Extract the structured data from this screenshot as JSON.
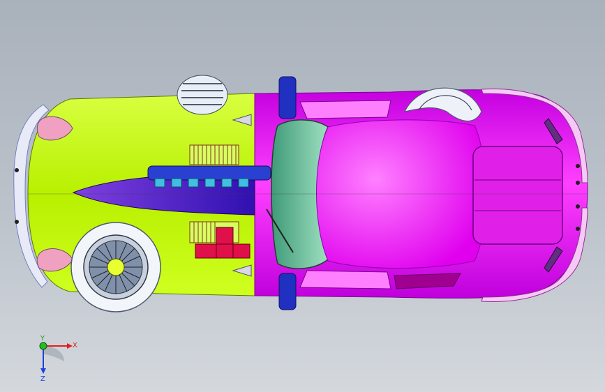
{
  "app": {
    "view": "Top",
    "model": "car assembly"
  },
  "colors": {
    "background_top": "#a9b1bb",
    "background_bottom": "#d4d8dd",
    "rear_body": "#b8f000",
    "rear_body_edge": "#e3ff3c",
    "front_body": "#f000f8",
    "front_body_dark": "#b000d0",
    "windshield": "#6ec8a0",
    "tire": "#f2f5fa",
    "spoke_hub": "#e8ff30",
    "bumper_blue": "#2030c0",
    "engine_purple": "#5020c8",
    "red_parts": "#e0104a",
    "axis_x": "#e02020",
    "axis_y": "#20c020",
    "axis_z": "#2040e0"
  },
  "triad": {
    "x_label": "X",
    "y_label": "Y",
    "z_label": "Z"
  }
}
